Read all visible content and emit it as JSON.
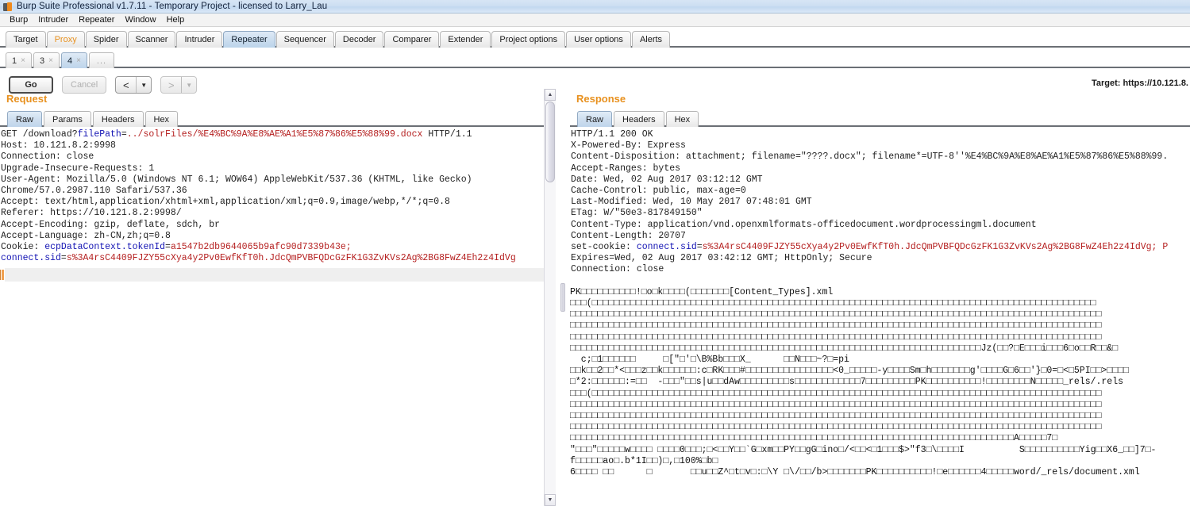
{
  "window": {
    "title": "Burp Suite Professional v1.7.11 - Temporary Project - licensed to Larry_Lau",
    "app_icon": "burp-logo-icon"
  },
  "menubar": {
    "items": [
      {
        "label": "Burp"
      },
      {
        "label": "Intruder"
      },
      {
        "label": "Repeater"
      },
      {
        "label": "Window"
      },
      {
        "label": "Help"
      }
    ]
  },
  "main_tabs": {
    "active": "Repeater",
    "items": [
      {
        "label": "Target",
        "state": "normal"
      },
      {
        "label": "Proxy",
        "state": "highlight"
      },
      {
        "label": "Spider",
        "state": "normal"
      },
      {
        "label": "Scanner",
        "state": "normal"
      },
      {
        "label": "Intruder",
        "state": "normal"
      },
      {
        "label": "Repeater",
        "state": "active"
      },
      {
        "label": "Sequencer",
        "state": "normal"
      },
      {
        "label": "Decoder",
        "state": "normal"
      },
      {
        "label": "Comparer",
        "state": "normal"
      },
      {
        "label": "Extender",
        "state": "normal"
      },
      {
        "label": "Project options",
        "state": "normal"
      },
      {
        "label": "User options",
        "state": "normal"
      },
      {
        "label": "Alerts",
        "state": "normal"
      }
    ]
  },
  "repeater_tabs": {
    "active": "4",
    "close_glyph": "×",
    "items": [
      {
        "label": "1",
        "state": "normal"
      },
      {
        "label": "3",
        "state": "normal"
      },
      {
        "label": "4",
        "state": "active"
      }
    ],
    "more_label": "..."
  },
  "toolbar": {
    "go_label": "Go",
    "cancel_label": "Cancel",
    "back_glyph": "<",
    "forward_glyph": ">",
    "dropdown_glyph": "▼",
    "target_label": "Target: https://10.121.8."
  },
  "request": {
    "title": "Request",
    "tabs": [
      {
        "label": "Raw",
        "state": "active"
      },
      {
        "label": "Params",
        "state": "normal"
      },
      {
        "label": "Headers",
        "state": "normal"
      },
      {
        "label": "Hex",
        "state": "normal"
      }
    ],
    "lines": [
      [
        {
          "t": "GET /download?",
          "c": "p"
        },
        {
          "t": "filePath",
          "c": "k"
        },
        {
          "t": "=",
          "c": "p"
        },
        {
          "t": "../solrFiles/%E4%BC%9A%E8%AE%A1%E5%87%86%E5%88%99.docx",
          "c": "v"
        },
        {
          "t": " HTTP/1.1",
          "c": "p"
        }
      ],
      [
        {
          "t": "Host: 10.121.8.2:9998",
          "c": "p"
        }
      ],
      [
        {
          "t": "Connection: close",
          "c": "p"
        }
      ],
      [
        {
          "t": "Upgrade-Insecure-Requests: 1",
          "c": "p"
        }
      ],
      [
        {
          "t": "User-Agent: Mozilla/5.0 (Windows NT 6.1; WOW64) AppleWebKit/537.36 (KHTML, like Gecko)",
          "c": "p"
        }
      ],
      [
        {
          "t": "Chrome/57.0.2987.110 Safari/537.36",
          "c": "p"
        }
      ],
      [
        {
          "t": "Accept: text/html,application/xhtml+xml,application/xml;q=0.9,image/webp,*/*;q=0.8",
          "c": "p"
        }
      ],
      [
        {
          "t": "Referer: https://10.121.8.2:9998/",
          "c": "p"
        }
      ],
      [
        {
          "t": "Accept-Encoding: gzip, deflate, sdch, br",
          "c": "p"
        }
      ],
      [
        {
          "t": "Accept-Language: zh-CN,zh;q=0.8",
          "c": "p"
        }
      ],
      [
        {
          "t": "Cookie: ",
          "c": "p"
        },
        {
          "t": "ecpDataContext.tokenId",
          "c": "k"
        },
        {
          "t": "=",
          "c": "p"
        },
        {
          "t": "a1547b2db9644065b9afc90d7339b43e;",
          "c": "v"
        }
      ],
      [
        {
          "t": "connect.sid",
          "c": "k"
        },
        {
          "t": "=",
          "c": "p"
        },
        {
          "t": "s%3A4rsC4409FJZY55cXya4y2Pv0EwfKfT0h.JdcQmPVBFQDcGzFK1G3ZvKVs2Ag%2BG8FwZ4Eh2z4IdVg",
          "c": "v"
        }
      ],
      [
        {
          "t": "",
          "c": "p"
        }
      ],
      [
        {
          "t": "",
          "c": "p"
        }
      ]
    ]
  },
  "response": {
    "title": "Response",
    "tabs": [
      {
        "label": "Raw",
        "state": "active"
      },
      {
        "label": "Headers",
        "state": "normal"
      },
      {
        "label": "Hex",
        "state": "normal"
      }
    ],
    "lines": [
      [
        {
          "t": "HTTP/1.1 200 OK",
          "c": "p"
        }
      ],
      [
        {
          "t": "X-Powered-By: Express",
          "c": "p"
        }
      ],
      [
        {
          "t": "Content-Disposition: attachment; filename=\"????.docx\"; filename*=UTF-8''%E4%BC%9A%E8%AE%A1%E5%87%86%E5%88%99.",
          "c": "p"
        }
      ],
      [
        {
          "t": "Accept-Ranges: bytes",
          "c": "p"
        }
      ],
      [
        {
          "t": "Date: Wed, 02 Aug 2017 03:12:12 GMT",
          "c": "p"
        }
      ],
      [
        {
          "t": "Cache-Control: public, max-age=0",
          "c": "p"
        }
      ],
      [
        {
          "t": "Last-Modified: Wed, 10 May 2017 07:48:01 GMT",
          "c": "p"
        }
      ],
      [
        {
          "t": "ETag: W/\"50e3-817849150\"",
          "c": "p"
        }
      ],
      [
        {
          "t": "Content-Type: application/vnd.openxmlformats-officedocument.wordprocessingml.document",
          "c": "p"
        }
      ],
      [
        {
          "t": "Content-Length: 20707",
          "c": "p"
        }
      ],
      [
        {
          "t": "set-cookie: ",
          "c": "p"
        },
        {
          "t": "connect.sid",
          "c": "k"
        },
        {
          "t": "=",
          "c": "p"
        },
        {
          "t": "s%3A4rsC4409FJZY55cXya4y2Pv0EwfKfT0h.JdcQmPVBFQDcGzFK1G3ZvKVs2Ag%2BG8FwZ4Eh2z4IdVg; P",
          "c": "v"
        }
      ],
      [
        {
          "t": "Expires=Wed, 02 Aug 2017 03:42:12 GMT; HttpOnly; Secure",
          "c": "p"
        }
      ],
      [
        {
          "t": "Connection: close",
          "c": "p"
        }
      ],
      [
        {
          "t": "",
          "c": "p"
        }
      ]
    ],
    "binary_lines": [
      "PK□□□□□□□□□□!□o□k□□□□(□□□□□□□[Content_Types].xml",
      "□□□(□□□□□□□□□□□□□□□□□□□□□□□□□□□□□□□□□□□□□□□□□□□□□□□□□□□□□□□□□□□□□□□□□□□□□□□□□□□□□□□□□□□□□□□□□□□□",
      "□□□□□□□□□□□□□□□□□□□□□□□□□□□□□□□□□□□□□□□□□□□□□□□□□□□□□□□□□□□□□□□□□□□□□□□□□□□□□□□□□□□□□□□□□□□□□□□□□",
      "□□□□□□□□□□□□□□□□□□□□□□□□□□□□□□□□□□□□□□□□□□□□□□□□□□□□□□□□□□□□□□□□□□□□□□□□□□□□□□□□□□□□□□□□□□□□□□□□□",
      "□□□□□□□□□□□□□□□□□□□□□□□□□□□□□□□□□□□□□□□□□□□□□□□□□□□□□□□□□□□□□□□□□□□□□□□□□□□□□□□□□□□□□□□□□□□□□□□□□",
      "□□□□□□□□□□□□□□□□□□□□□□□□□□□□□□□□□□□□□□□□□□□□□□□□□□□□□□□□□□□□□□□□□□□□□□□□□□□Jz(□□?□E□□□i□□□6□o□□R□□&□",
      "  c;□1□□□□□□     □[\"□'□\\B%Bb□□□X_      □□N□□□~?□=pi",
      "□□k□□2□□*<□□□z□□k□□□□□□:c□RK□□□#□□□□□□□□□□□□□□□□<0_□□□□□-y□□□□Sm□h□□□□□□□g'□□□□G□6□□'}□0=□<□5PI□□>□□□□",
      "□*2:□□□□□□:=□□  -□□□\"□□s|u□□dAw□□□□□□□□□s□□□□□□□□□□□□7□□□□□□□□□PK□□□□□□□□□□!□□□□□□□□N□□□□□_rels/.rels",
      "□□□(□□□□□□□□□□□□□□□□□□□□□□□□□□□□□□□□□□□□□□□□□□□□□□□□□□□□□□□□□□□□□□□□□□□□□□□□□□□□□□□□□□□□□□□□□□□□□",
      "□□□□□□□□□□□□□□□□□□□□□□□□□□□□□□□□□□□□□□□□□□□□□□□□□□□□□□□□□□□□□□□□□□□□□□□□□□□□□□□□□□□□□□□□□□□□□□□□□",
      "□□□□□□□□□□□□□□□□□□□□□□□□□□□□□□□□□□□□□□□□□□□□□□□□□□□□□□□□□□□□□□□□□□□□□□□□□□□□□□□□□□□□□□□□□□□□□□□□□",
      "□□□□□□□□□□□□□□□□□□□□□□□□□□□□□□□□□□□□□□□□□□□□□□□□□□□□□□□□□□□□□□□□□□□□□□□□□□□□□□□□□□□□□□□□□□□□□□□□□",
      "□□□□□□□□□□□□□□□□□□□□□□□□□□□□□□□□□□□□□□□□□□□□□□□□□□□□□□□□□□□□□□□□□□□□□□□□□□□□□□□□□A□□□□□7□",
      "\"□□□\"□□□□□w□□□□ □□□□0□□□;□<□□Y□□`G□xm□□PY□□gG□ino□/<□□<□1□□□$>\"f3□\\□□□□I          S□□□□□□□□□□Yig□□X6_□□]7□-",
      "f□□□□□ao□.b*1I□□)□,□100%□b□",
      "6□□□□ □□      □       □□u□□Z^□t□v□:□\\Y □\\/□□/b>□□□□□□□PK□□□□□□□□□□!□e□□□□□□4□□□□□word/_rels/document.xml"
    ]
  },
  "scrollbars": {
    "up_glyph": "▲",
    "down_glyph": "▼"
  },
  "colors": {
    "accent_orange": "#e8911f",
    "header_blue": "#1414b4",
    "value_red": "#b52020",
    "tab_active": "#c9dcee"
  }
}
